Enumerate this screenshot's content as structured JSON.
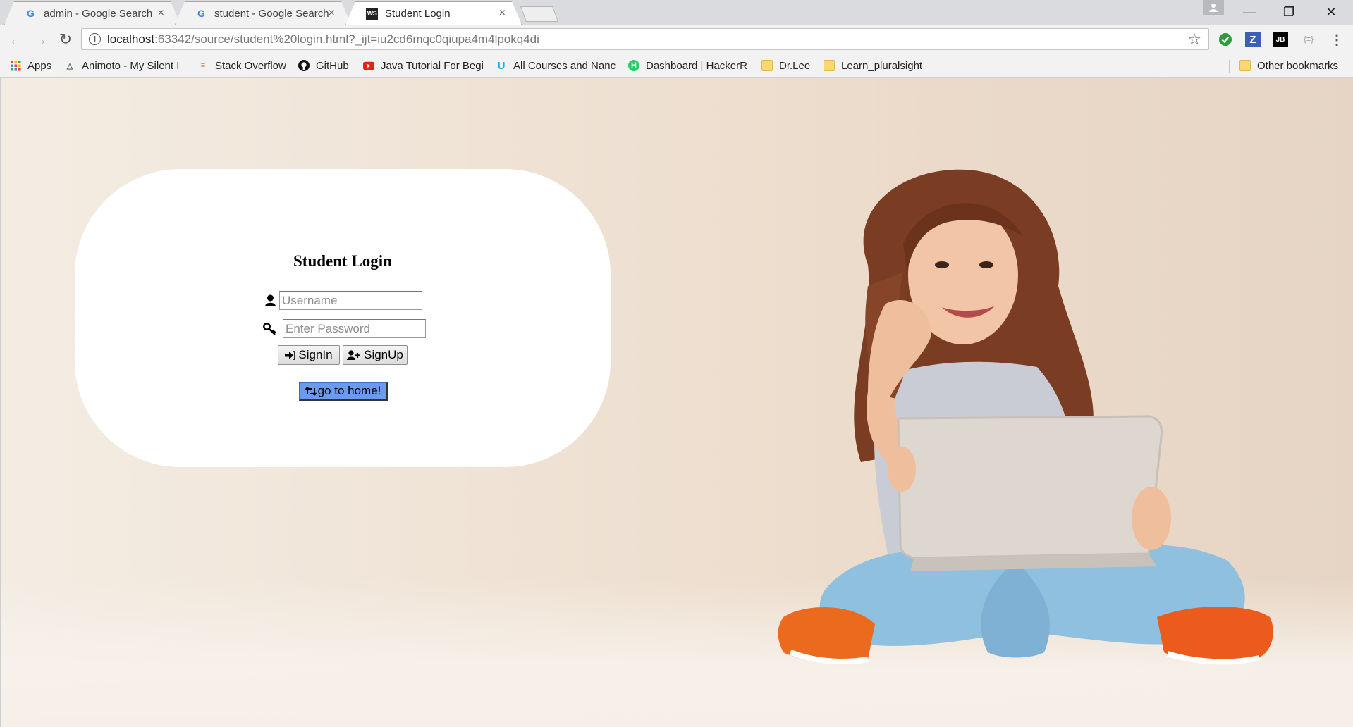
{
  "browser": {
    "tabs": [
      {
        "title": "admin - Google Search",
        "favicon": "google-g-icon",
        "active": false
      },
      {
        "title": "student - Google Search",
        "favicon": "google-g-icon",
        "active": false
      },
      {
        "title": "Student Login",
        "favicon": "webstorm-icon",
        "active": true
      }
    ],
    "favicon_google": "G",
    "favicon_ws": "WS",
    "close_glyph": "×",
    "url_host": "localhost",
    "url_rest": ":63342/source/student%20login.html?_ijt=iu2cd6mqc0qiupa4m4lpokq4di",
    "window_controls": {
      "minimize": "—",
      "restore": "❐",
      "close": "✕"
    },
    "extensions": [
      {
        "name": "check-extension-icon",
        "glyph": "✔",
        "color": "#2e9b3f"
      },
      {
        "name": "zotero-extension-icon",
        "glyph": "Z",
        "color": "#3b5fb8"
      },
      {
        "name": "jetbrains-extension-icon",
        "glyph": "JB",
        "color": "#000000"
      },
      {
        "name": "json-extension-icon",
        "glyph": "{≡}",
        "color": "#9a9a9a"
      }
    ]
  },
  "bookmarks": {
    "items": [
      {
        "label": "Apps",
        "icon": "apps-grid-icon"
      },
      {
        "label": "Animoto - My Silent I",
        "icon": "animoto-icon"
      },
      {
        "label": "Stack Overflow",
        "icon": "stackoverflow-icon"
      },
      {
        "label": "GitHub",
        "icon": "github-icon"
      },
      {
        "label": "Java Tutorial For Begi",
        "icon": "youtube-icon"
      },
      {
        "label": "All Courses and Nanc",
        "icon": "udacity-icon"
      },
      {
        "label": "Dashboard | HackerR",
        "icon": "hackerrank-icon"
      },
      {
        "label": "Dr.Lee",
        "icon": "folder-icon"
      },
      {
        "label": "Learn_pluralsight",
        "icon": "folder-icon"
      }
    ],
    "other": "Other bookmarks"
  },
  "login": {
    "title": "Student Login",
    "username_placeholder": "Username",
    "password_placeholder": "Enter Password",
    "signin_label": "SignIn",
    "signup_label": "SignUp",
    "home_label": "go to home!"
  },
  "colors": {
    "home_button": "#6a9bee",
    "card": "#ffffff"
  }
}
